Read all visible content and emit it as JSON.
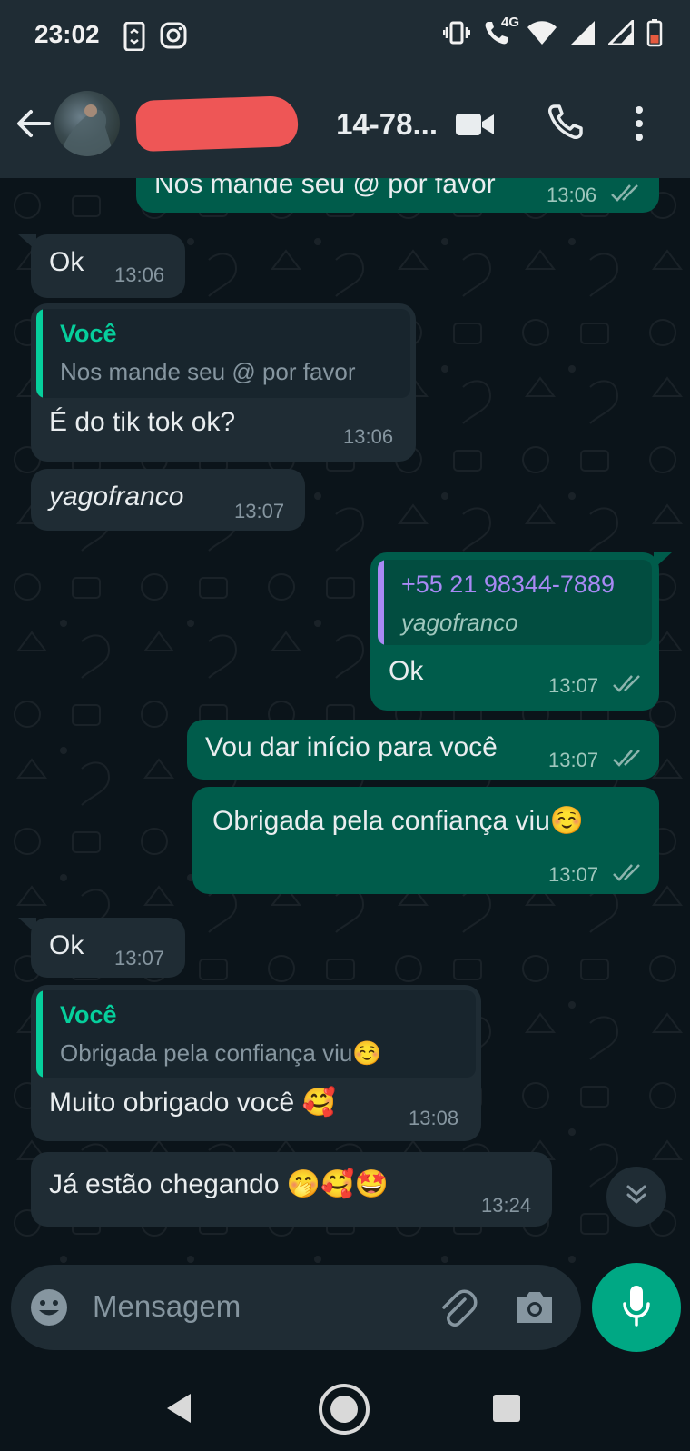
{
  "status_bar": {
    "time": "23:02",
    "network_label": "4G"
  },
  "header": {
    "contact_name_visible": "14-78...",
    "icons": [
      "back-arrow-icon",
      "video-call-icon",
      "voice-call-icon",
      "more-options-icon"
    ]
  },
  "messages": [
    {
      "direction": "out",
      "text": "Nos mande seu @ por favor",
      "time": "13:06",
      "status": "read"
    },
    {
      "direction": "in",
      "text": "Ok",
      "time": "13:06"
    },
    {
      "direction": "in",
      "quote_author": "Você",
      "quote_text": "Nos mande seu @ por favor",
      "text": "É do tik tok ok?",
      "time": "13:06"
    },
    {
      "direction": "in",
      "text": "yagofranco",
      "time": "13:07"
    },
    {
      "direction": "out",
      "quote_author": "+55 21 98344-7889",
      "quote_text": "yagofranco",
      "text": "Ok",
      "time": "13:07",
      "status": "read"
    },
    {
      "direction": "out",
      "text": "Vou dar início para você",
      "time": "13:07",
      "status": "read"
    },
    {
      "direction": "out",
      "text": "Obrigada pela confiança viu☺️",
      "time": "13:07",
      "status": "read"
    },
    {
      "direction": "in",
      "text": "Ok",
      "time": "13:07"
    },
    {
      "direction": "in",
      "quote_author": "Você",
      "quote_text": "Obrigada pela confiança viu☺️",
      "text": "Muito obrigado você 🥰",
      "time": "13:08"
    },
    {
      "direction": "in",
      "text": "Já estão chegando 🤭🥰🤩",
      "time": "13:24"
    }
  ],
  "composer": {
    "placeholder": "Mensagem"
  },
  "colors": {
    "background": "#0b141a",
    "header": "#1f2c34",
    "incoming_bubble": "#1f2c34",
    "outgoing_bubble": "#005c4b",
    "accent": "#00a884",
    "quote_you": "#06cf9c",
    "quote_contact": "#a889f4",
    "read_ticks": "#8cb4ad"
  }
}
